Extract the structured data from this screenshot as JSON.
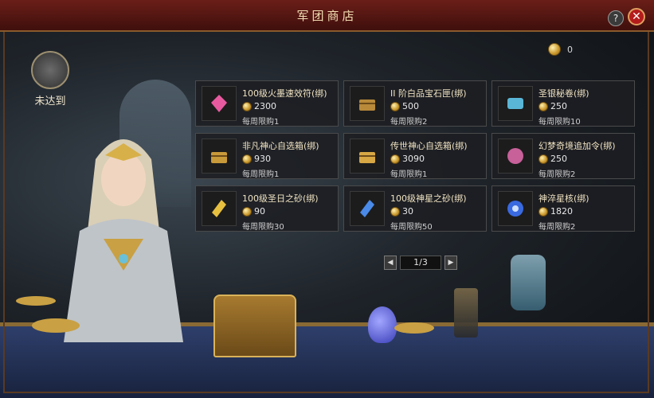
{
  "header": {
    "title": "军团商店"
  },
  "status": {
    "label": "未达到"
  },
  "currency": {
    "amount": "0",
    "icon": "gold-coin-icon"
  },
  "items": [
    {
      "name": "100级火墨速效符(绑)",
      "price": "2300",
      "limit": "每周限购1",
      "icon": "pink-gem-icon",
      "color": "#e85aa0"
    },
    {
      "name": "II 阶白品宝石匣(绑)",
      "price": "500",
      "limit": "每周限购2",
      "icon": "treasure-chest-icon",
      "color": "#b88a3a"
    },
    {
      "name": "圣银秘卷(绑)",
      "price": "250",
      "limit": "每周限购10",
      "icon": "scroll-icon",
      "color": "#5ab6d6"
    },
    {
      "name": "非凡神心自选箱(绑)",
      "price": "930",
      "limit": "每周限购1",
      "icon": "gold-chest-icon",
      "color": "#c99a3a"
    },
    {
      "name": "传世神心自选箱(绑)",
      "price": "3090",
      "limit": "每周限购1",
      "icon": "gold-chest-icon",
      "color": "#d8a845"
    },
    {
      "name": "幻梦奇境追加令(绑)",
      "price": "250",
      "limit": "每周限购2",
      "icon": "pink-orb-icon",
      "color": "#c8609a"
    },
    {
      "name": "100级圣日之砂(绑)",
      "price": "90",
      "limit": "每周限购30",
      "icon": "yellow-crystal-icon",
      "color": "#e8c040"
    },
    {
      "name": "100级神星之砂(绑)",
      "price": "30",
      "limit": "每周限购50",
      "icon": "blue-crystal-icon",
      "color": "#4a8ae8"
    },
    {
      "name": "神淬星核(绑)",
      "price": "1820",
      "limit": "每周限购2",
      "icon": "blue-star-core-icon",
      "color": "#3a6ae0"
    }
  ],
  "pagination": {
    "current": "1/3",
    "prev": "◀",
    "next": "▶"
  },
  "buttons": {
    "help": "?",
    "close": "✕"
  }
}
